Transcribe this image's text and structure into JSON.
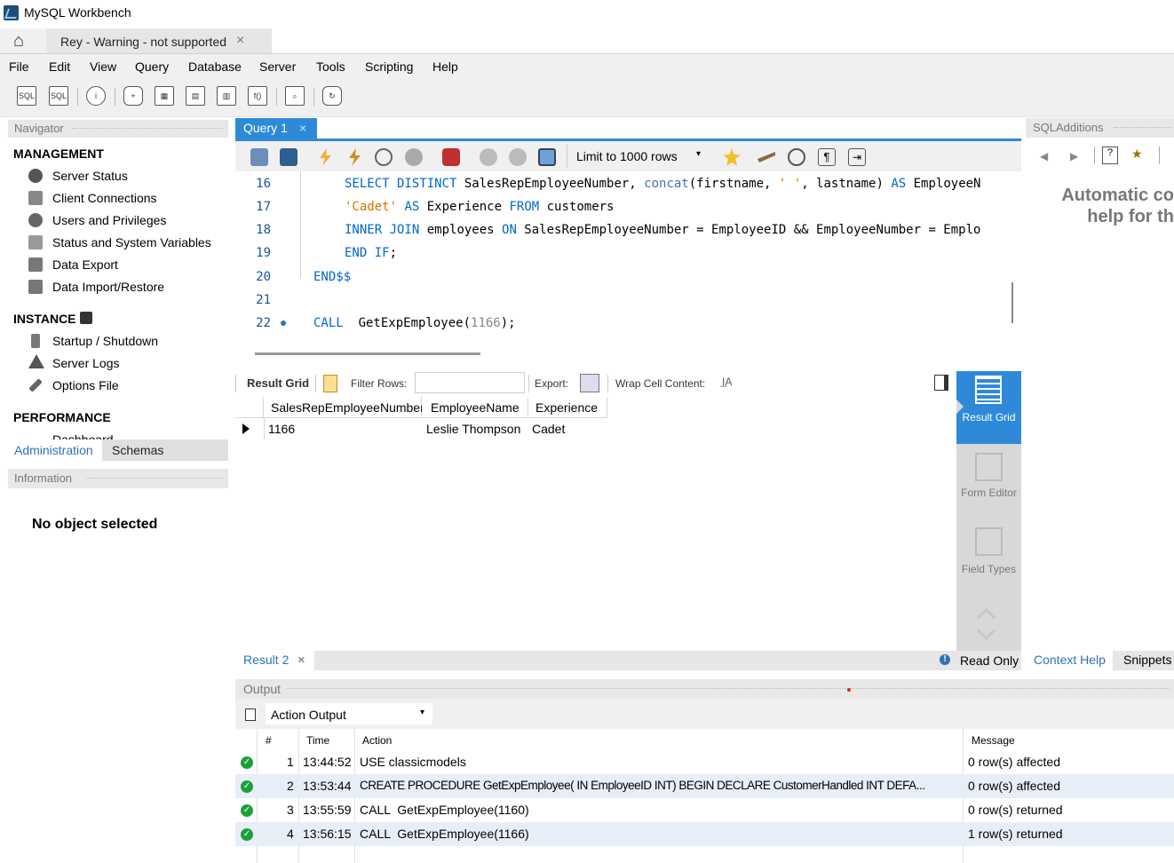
{
  "window": {
    "title": "MySQL Workbench"
  },
  "connection_tab": {
    "label": "Rey - Warning - not supported",
    "close": "×"
  },
  "menu": [
    "File",
    "Edit",
    "View",
    "Query",
    "Database",
    "Server",
    "Tools",
    "Scripting",
    "Help"
  ],
  "navigator": {
    "header": "Navigator",
    "management": {
      "title": "MANAGEMENT",
      "items": [
        "Server Status",
        "Client Connections",
        "Users and Privileges",
        "Status and System Variables",
        "Data Export",
        "Data Import/Restore"
      ]
    },
    "instance": {
      "title": "INSTANCE",
      "items": [
        "Startup / Shutdown",
        "Server Logs",
        "Options File"
      ]
    },
    "performance": {
      "title": "PERFORMANCE",
      "items": [
        "Dashboard"
      ]
    },
    "tabs": {
      "administration": "Administration",
      "schemas": "Schemas"
    }
  },
  "information": {
    "header": "Information",
    "text": "No object selected"
  },
  "query_tab": {
    "label": "Query 1",
    "close": "×"
  },
  "sql_toolbar": {
    "limit": "Limit to 1000 rows"
  },
  "editor": {
    "line_numbers": [
      "16",
      "17",
      "18",
      "19",
      "20",
      "21",
      "22"
    ]
  },
  "result_toolbar": {
    "result_grid": "Result Grid",
    "filter_rows": "Filter Rows:",
    "export": "Export:",
    "wrap": "Wrap Cell Content:"
  },
  "result_table": {
    "columns": [
      "SalesRepEmployeeNumber",
      "EmployeeName",
      "Experience"
    ],
    "rows": [
      [
        "1166",
        "Leslie Thompson",
        "Cadet"
      ]
    ]
  },
  "side_tabs": {
    "result_grid": "Result Grid",
    "form_editor": "Form Editor",
    "field_types": "Field Types"
  },
  "result_bar": {
    "tab": "Result 2",
    "close": "×",
    "read_only": "Read Only"
  },
  "sql_additions": {
    "header": "SQLAdditions",
    "text_line1": "Automatic co",
    "text_line2": "help for th",
    "context_help": "Context Help",
    "snippets": "Snippets"
  },
  "output": {
    "header": "Output",
    "selector": "Action Output",
    "columns": {
      "num": "#",
      "time": "Time",
      "action": "Action",
      "message": "Message"
    },
    "rows": [
      {
        "num": "1",
        "time": "13:44:52",
        "action": "USE classicmodels",
        "message": "0 row(s) affected"
      },
      {
        "num": "2",
        "time": "13:53:44",
        "action": "CREATE PROCEDURE GetExpEmployee( IN EmployeeID INT) BEGIN DECLARE CustomerHandled INT DEFA...",
        "message": "0 row(s) affected"
      },
      {
        "num": "3",
        "time": "13:55:59",
        "action": "CALL  GetExpEmployee(1160)",
        "message": "0 row(s) returned"
      },
      {
        "num": "4",
        "time": "13:56:15",
        "action": "CALL  GetExpEmployee(1166)",
        "message": "1 row(s) returned"
      }
    ]
  },
  "colors": {
    "accent": "#2e8ad8",
    "keyword": "#0066cc",
    "string": "#e07000",
    "ok": "#1f9e3c"
  }
}
